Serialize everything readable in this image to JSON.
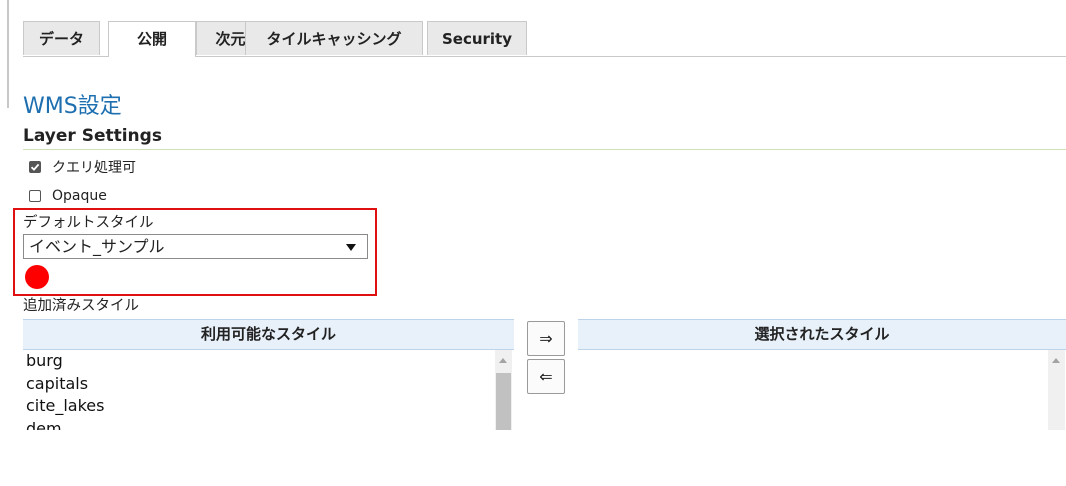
{
  "tabs": [
    {
      "label": "データ",
      "active": false
    },
    {
      "label": "公開",
      "active": true
    },
    {
      "label": "次元",
      "active": false
    },
    {
      "label": "タイルキャッシング",
      "active": false
    },
    {
      "label": "Security",
      "active": false
    }
  ],
  "section": {
    "title": "WMS設定",
    "subtitle": "Layer Settings"
  },
  "options": {
    "queryable": {
      "label": "クエリ処理可",
      "checked": true
    },
    "opaque": {
      "label": "Opaque",
      "checked": false
    }
  },
  "default_style": {
    "label": "デフォルトスタイル",
    "selected": "イベント_サンプル",
    "preview_color": "#ff0000"
  },
  "additional_styles": {
    "label": "追加済みスタイル",
    "available_header": "利用可能なスタイル",
    "selected_header": "選択されたスタイル",
    "available": [
      "burg",
      "capitals",
      "cite_lakes",
      "dem"
    ],
    "selected": [],
    "add_button": "⇒",
    "remove_button": "⇐"
  },
  "colors": {
    "accent": "#1e6fb0",
    "highlight": "#e01010",
    "header_bg": "#e8f1fa"
  }
}
